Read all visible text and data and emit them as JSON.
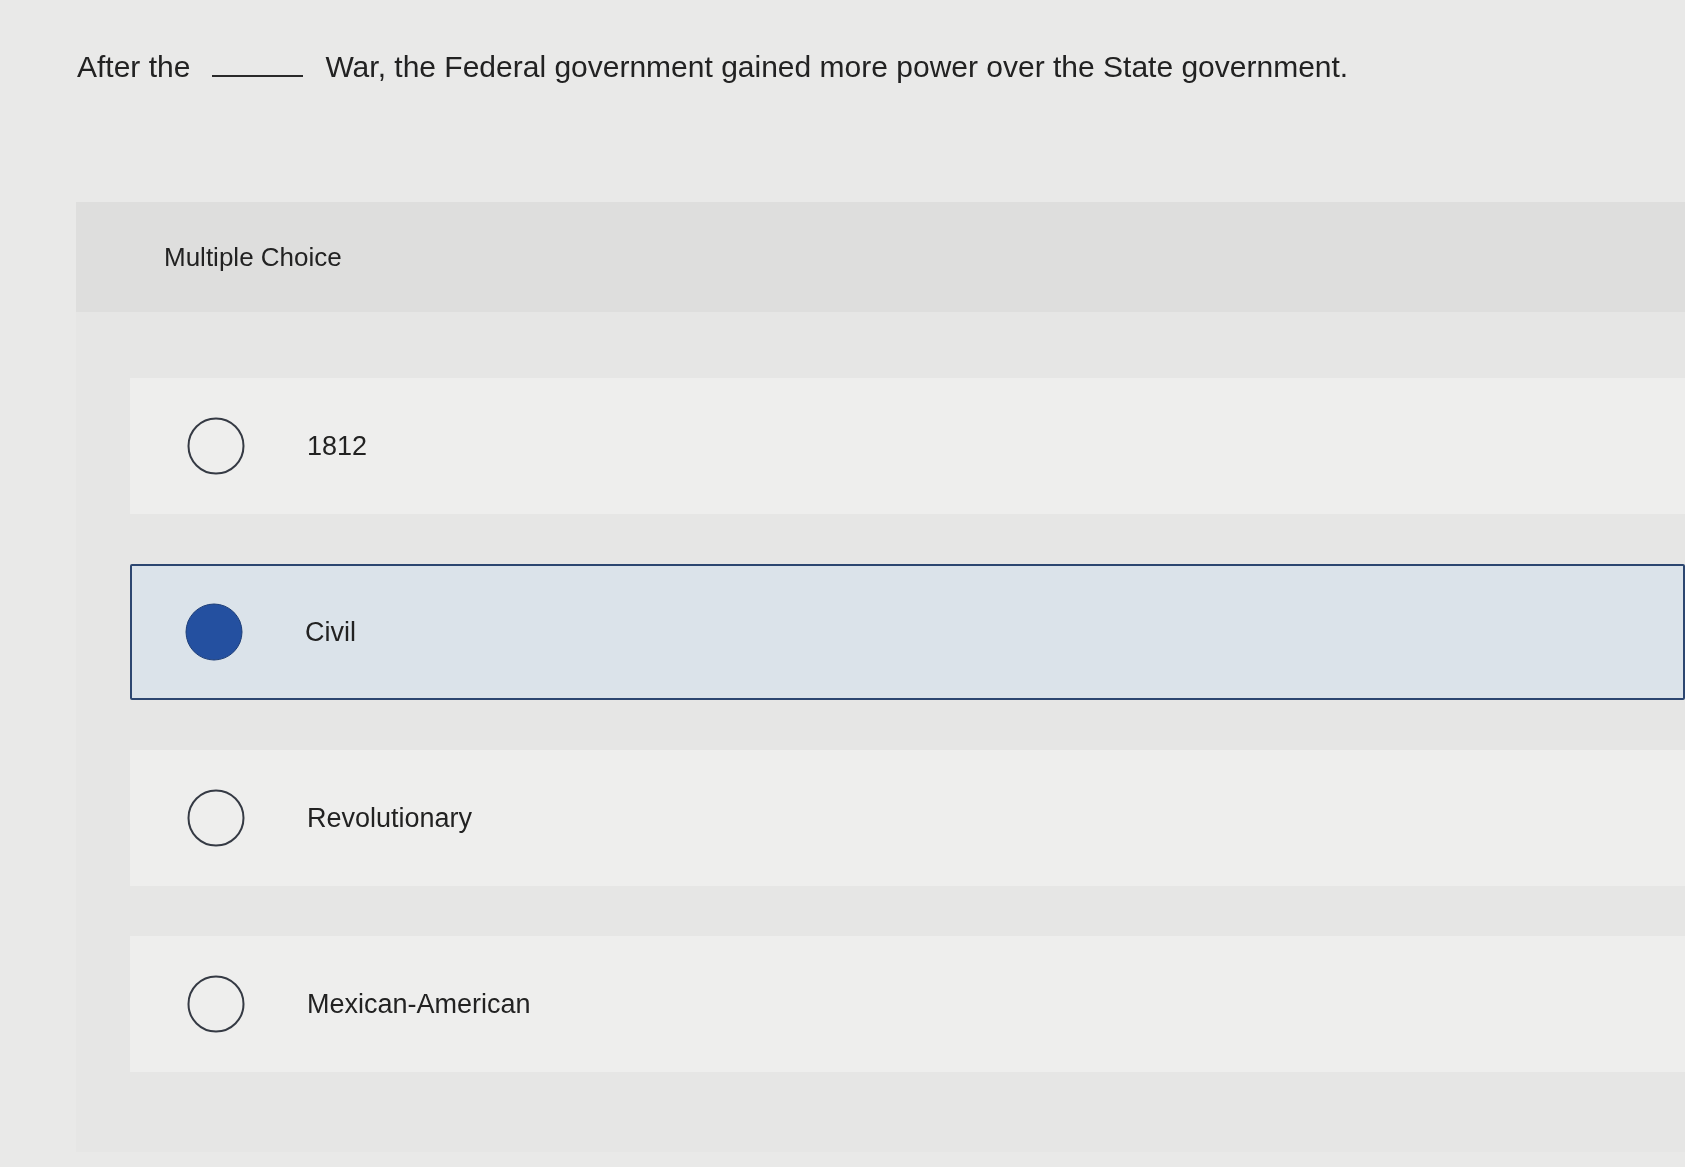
{
  "question": {
    "parts": [
      {
        "kind": "text",
        "text": "After the"
      },
      {
        "kind": "blank"
      },
      {
        "kind": "text",
        "text": "War, the Federal government gained more power over the State government."
      }
    ]
  },
  "answer_panel": {
    "heading": "Multiple Choice",
    "options": [
      {
        "label": "1812",
        "selected": false
      },
      {
        "label": "Civil",
        "selected": true
      },
      {
        "label": "Revolutionary",
        "selected": false
      },
      {
        "label": "Mexican-American",
        "selected": false
      }
    ]
  }
}
